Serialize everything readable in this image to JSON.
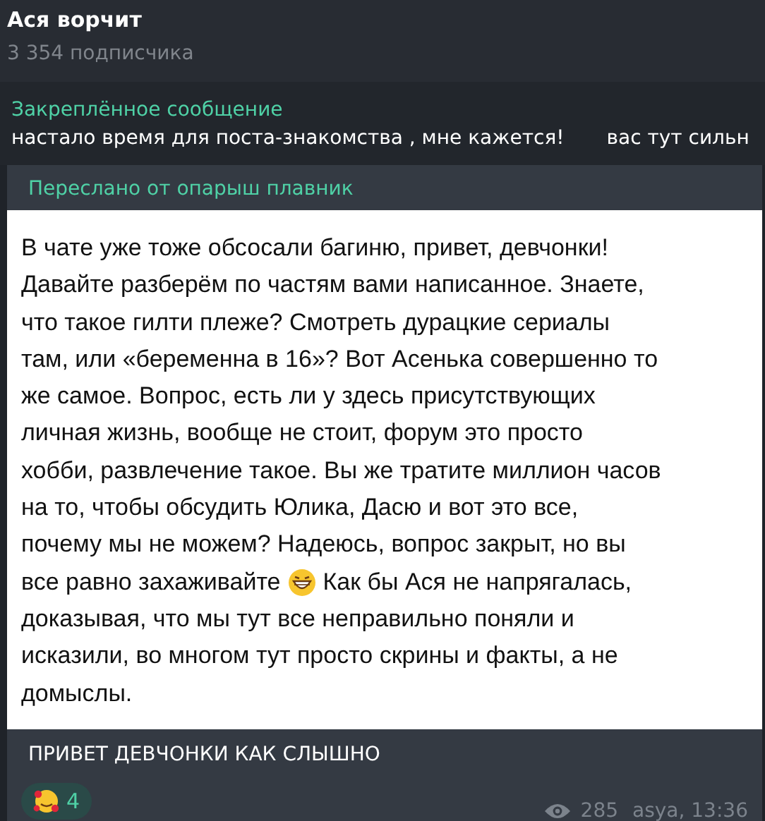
{
  "header": {
    "title": "Ася ворчит",
    "subtitle": "3 354 подписчика"
  },
  "pinned": {
    "label": "Закреплённое сообщение",
    "text": "настало время для поста-знакомства , мне кажется!",
    "text_more": "вас тут сильн"
  },
  "message": {
    "forwarded": "Переслано от опарыш плавник",
    "image_lines": [
      [
        {
          "kind": "text",
          "text": "В чате уже тоже обсосали багиню, привет, девчонки!"
        }
      ],
      [
        {
          "kind": "text",
          "text": "Давайте разберём по частям вами написанное. Знаете,"
        }
      ],
      [
        {
          "kind": "text",
          "text": "что такое гилти плеже? Смотреть дурацкие сериалы"
        }
      ],
      [
        {
          "kind": "text",
          "text": "там, или «беременна в 16»? Вот Асенька совершенно то"
        }
      ],
      [
        {
          "kind": "text",
          "text": "же самое. Вопрос, есть ли у здесь присутствующих"
        }
      ],
      [
        {
          "kind": "text",
          "text": "личная жизнь, вообще не стоит, форум это просто"
        }
      ],
      [
        {
          "kind": "text",
          "text": "хобби, развлечение такое. Вы же тратите миллион часов"
        }
      ],
      [
        {
          "kind": "text",
          "text": "на то, чтобы обсудить Юлика, Дасю и вот это все,"
        }
      ],
      [
        {
          "kind": "text",
          "text": "почему мы не можем? Надеюсь, вопрос закрыт, но вы"
        }
      ],
      [
        {
          "kind": "text",
          "text": "все равно захаживайте"
        },
        {
          "kind": "emoji"
        },
        {
          "kind": "text",
          "text": "Как бы Ася не напрягалась,"
        }
      ],
      [
        {
          "kind": "text",
          "text": "доказывая, что мы тут все неправильно поняли и"
        }
      ],
      [
        {
          "kind": "text",
          "text": "исказили, во многом тут просто скрины и факты, а не"
        }
      ],
      [
        {
          "kind": "text",
          "text": "домыслы."
        }
      ]
    ],
    "caption": "ПРИВЕТ ДЕВЧОНКИ КАК СЛЫШНО",
    "reaction": {
      "count": "4",
      "selected": false
    },
    "views": "285",
    "signature": "asya, 13:36"
  }
}
